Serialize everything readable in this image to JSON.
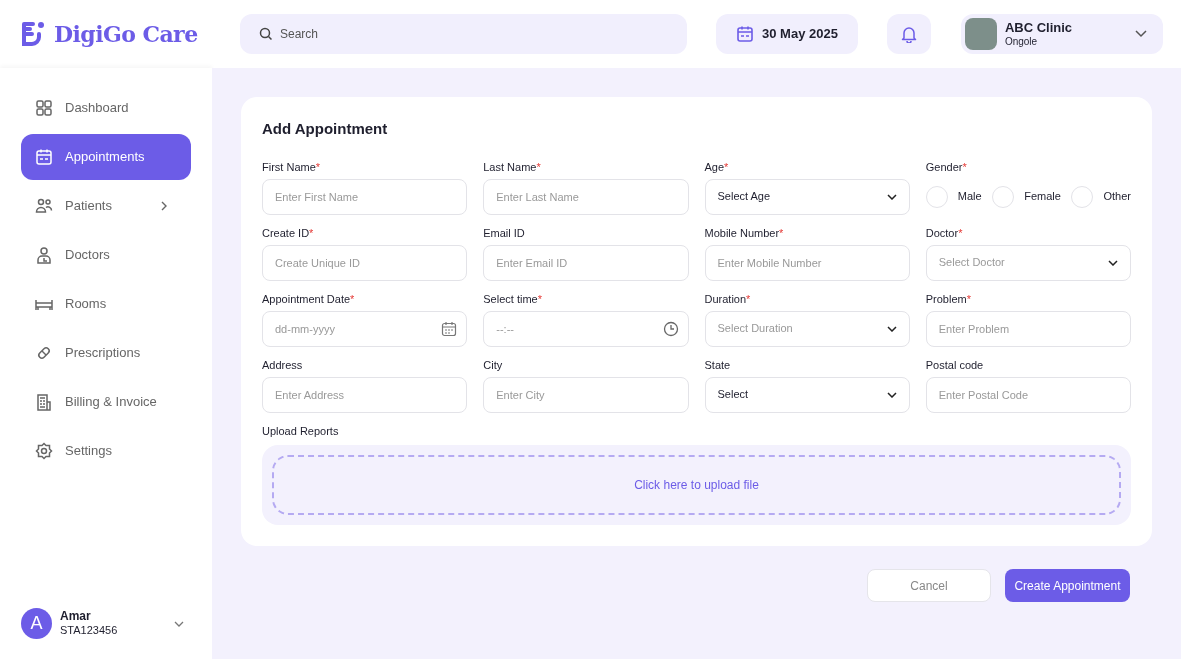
{
  "brand": {
    "name": "DigiGo Care"
  },
  "header": {
    "search_placeholder": "Search",
    "date": "30 May 2025",
    "clinic": {
      "name": "ABC Clinic",
      "location": "Ongole"
    }
  },
  "sidebar": {
    "items": [
      {
        "label": "Dashboard",
        "selected": false,
        "has_submenu": false
      },
      {
        "label": "Appointments",
        "selected": true,
        "has_submenu": false
      },
      {
        "label": "Patients",
        "selected": false,
        "has_submenu": true
      },
      {
        "label": "Doctors",
        "selected": false,
        "has_submenu": false
      },
      {
        "label": "Rooms",
        "selected": false,
        "has_submenu": false
      },
      {
        "label": "Prescriptions",
        "selected": false,
        "has_submenu": false
      },
      {
        "label": "Billing & Invoice",
        "selected": false,
        "has_submenu": false
      },
      {
        "label": "Settings",
        "selected": false,
        "has_submenu": false
      }
    ],
    "user": {
      "initial": "A",
      "name": "Amar",
      "id": "STA123456"
    }
  },
  "form": {
    "title": "Add Appointment",
    "fields": [
      {
        "kind": "text",
        "label": "First Name",
        "required_mark": "*",
        "placeholder": "Enter First Name"
      },
      {
        "kind": "text",
        "label": "Last Name",
        "required_mark": "*",
        "placeholder": "Enter Last Name"
      },
      {
        "kind": "select",
        "label": "Age",
        "required_mark": "*",
        "value": "Select Age"
      },
      {
        "kind": "radio",
        "label": "Gender",
        "required_mark": "*",
        "options": [
          {
            "label": "Male",
            "selected": false
          },
          {
            "label": "Female",
            "selected": false
          },
          {
            "label": "Other",
            "selected": false
          }
        ]
      },
      {
        "kind": "text",
        "label": "Create ID",
        "required_mark": "*",
        "placeholder": "Create Unique ID"
      },
      {
        "kind": "text",
        "label": "Email ID",
        "placeholder": "Enter Email ID"
      },
      {
        "kind": "text",
        "label": "Mobile Number",
        "required_mark": "*",
        "placeholder": "Enter Mobile Number"
      },
      {
        "kind": "select",
        "label": "Doctor",
        "required_mark": "*",
        "placeholder": "Select Doctor"
      },
      {
        "kind": "date",
        "label": "Appointment Date",
        "required_mark": "*",
        "placeholder": "dd-mm-yyyy"
      },
      {
        "kind": "time",
        "label": "Select time",
        "required_mark": "*",
        "placeholder": "--:--"
      },
      {
        "kind": "select",
        "label": "Duration",
        "required_mark": "*",
        "placeholder": "Select Duration"
      },
      {
        "kind": "text",
        "label": "Problem",
        "required_mark": "*",
        "placeholder": "Enter Problem"
      },
      {
        "kind": "text",
        "label": "Address",
        "placeholder": "Enter Address"
      },
      {
        "kind": "text",
        "label": "City",
        "placeholder": "Enter City"
      },
      {
        "kind": "select",
        "label": "State",
        "value": "Select"
      },
      {
        "kind": "text",
        "label": "Postal code",
        "placeholder": "Enter Postal Code"
      }
    ],
    "upload": {
      "label": "Upload Reports",
      "prompt": "Click here to upload file"
    }
  },
  "actions": {
    "cancel": "Cancel",
    "submit": "Create Appointment"
  }
}
